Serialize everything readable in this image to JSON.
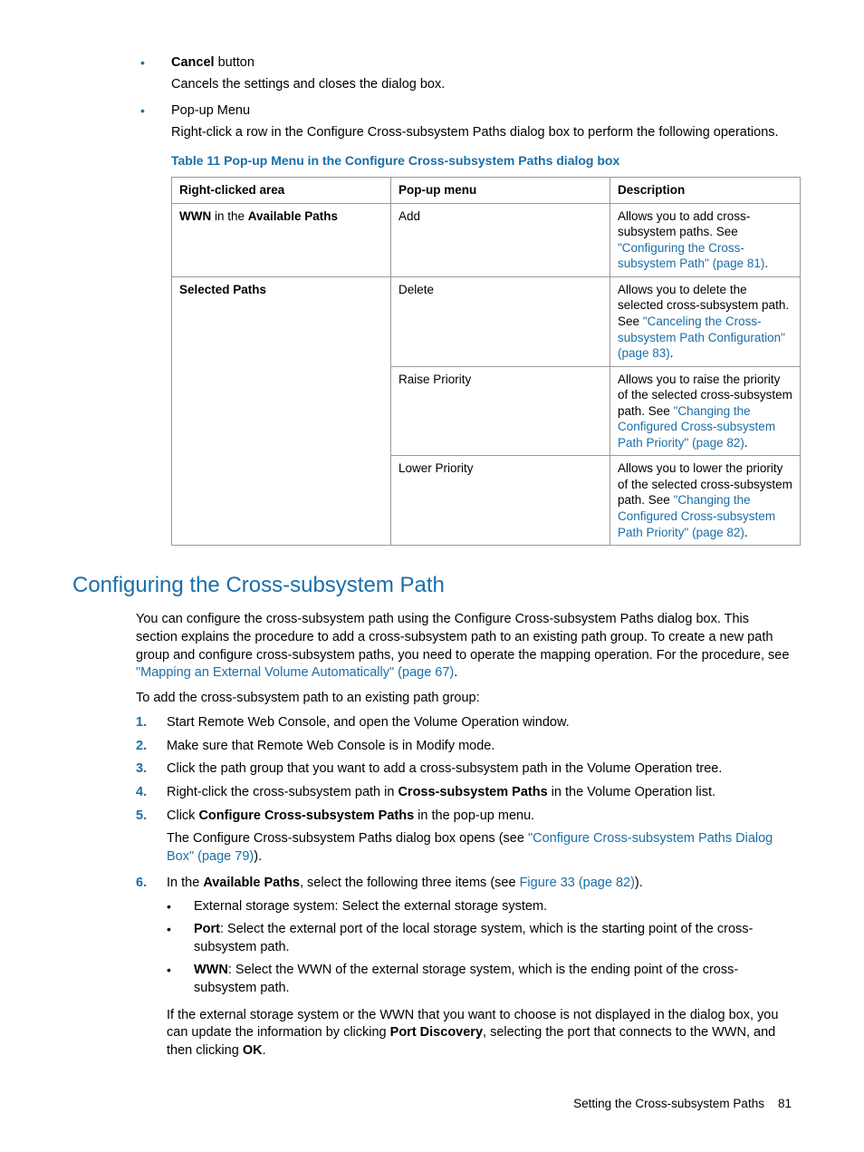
{
  "top_bullets": {
    "cancel_bold": "Cancel",
    "cancel_rest": " button",
    "cancel_desc": "Cancels the settings and closes the dialog box.",
    "popup_label": "Pop-up Menu",
    "popup_desc": "Right-click a row in the Configure Cross-subsystem Paths dialog box to perform the following operations."
  },
  "table": {
    "caption": "Table 11 Pop-up Menu in the Configure Cross-subsystem Paths dialog box",
    "h1": "Right-clicked area",
    "h2": "Pop-up menu",
    "h3": "Description",
    "r1c1_a": "WWN",
    "r1c1_b": " in the ",
    "r1c1_c": "Available Paths",
    "r1c2": "Add",
    "r1c3_a": "Allows you to add cross-subsystem paths. See ",
    "r1c3_link": "\"Configuring the Cross-subsystem Path\" (page 81)",
    "r1c3_b": ".",
    "r2c1": "Selected Paths",
    "r2c2": "Delete",
    "r2c3_a": "Allows you to delete the selected cross-subsystem path. See ",
    "r2c3_link": "\"Canceling the Cross-subsystem Path Configuration\" (page 83)",
    "r2c3_b": ".",
    "r3c2": "Raise Priority",
    "r3c3_a": "Allows you to raise the priority of the selected cross-subsystem path. See ",
    "r3c3_link": "\"Changing the Configured Cross-subsystem Path Priority\" (page 82)",
    "r3c3_b": ".",
    "r4c2": "Lower Priority",
    "r4c3_a": "Allows you to lower the priority of the selected cross-subsystem path. See ",
    "r4c3_link": "\"Changing the Configured Cross-subsystem Path Priority\" (page 82)",
    "r4c3_b": "."
  },
  "section": {
    "heading": "Configuring the Cross-subsystem Path",
    "p1_a": "You can configure the cross-subsystem path using the Configure Cross-subsystem Paths dialog box. This section explains the procedure to add a cross-subsystem path to an existing path group. To create a new path group and configure cross-subsystem paths, you need to operate the mapping operation. For the procedure, see ",
    "p1_link": "\"Mapping an External Volume Automatically\" (page 67)",
    "p1_b": ".",
    "p2": "To add the cross-subsystem path to an existing path group:"
  },
  "steps": {
    "n1": "1.",
    "s1": "Start Remote Web Console, and open the Volume Operation window.",
    "n2": "2.",
    "s2": "Make sure that Remote Web Console is in Modify mode.",
    "n3": "3.",
    "s3": "Click the path group that you want to add a cross-subsystem path in the Volume Operation tree.",
    "n4": "4.",
    "s4_a": "Right-click the cross-subsystem path in ",
    "s4_b": "Cross-subsystem Paths",
    "s4_c": " in the Volume Operation list.",
    "n5": "5.",
    "s5_a": "Click ",
    "s5_b": "Configure Cross-subsystem Paths",
    "s5_c": " in the pop-up menu.",
    "s5_sub_a": "The Configure Cross-subsystem Paths dialog box opens (see ",
    "s5_sub_link": "\"Configure Cross-subsystem Paths Dialog Box\" (page 79)",
    "s5_sub_b": ").",
    "n6": "6.",
    "s6_a": "In the ",
    "s6_b": "Available Paths",
    "s6_c": ", select the following three items (see ",
    "s6_link": "Figure 33 (page 82)",
    "s6_d": ").",
    "b1": "External storage system: Select the external storage system.",
    "b2_a": "Port",
    "b2_b": ": Select the external port of the local storage system, which is the starting point of the cross-subsystem path.",
    "b3_a": "WWN",
    "b3_b": ": Select the WWN of the external storage system, which is the ending point of the cross-subsystem path.",
    "tail_a": "If the external storage system or the WWN that you want to choose is not displayed in the dialog box, you can update the information by clicking ",
    "tail_b": "Port Discovery",
    "tail_c": ", selecting the port that connects to the WWN, and then clicking ",
    "tail_d": "OK",
    "tail_e": "."
  },
  "footer": {
    "text": "Setting the Cross-subsystem Paths",
    "page": "81"
  }
}
